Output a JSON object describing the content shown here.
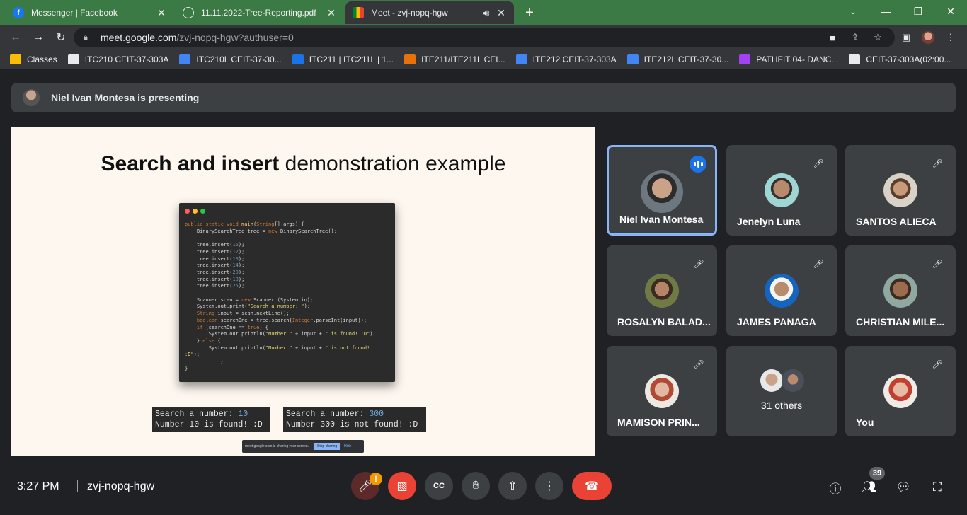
{
  "browser": {
    "tabs": [
      {
        "title": "Messenger | Facebook",
        "icon": "facebook-icon"
      },
      {
        "title": "11.11.2022-Tree-Reporting.pdf",
        "icon": "globe-icon"
      },
      {
        "title": "Meet - zvj-nopq-hgw",
        "icon": "meet-icon",
        "active": true
      }
    ],
    "url_host": "meet.google.com",
    "url_path": "/zvj-nopq-hgw?authuser=0",
    "bookmarks": [
      {
        "label": "Classes",
        "color": "#fbbc04"
      },
      {
        "label": "ITC210 CEIT-37-303A",
        "color": "#e8eaed"
      },
      {
        "label": "ITC210L CEIT-37-30...",
        "color": "#4285f4"
      },
      {
        "label": "ITC211 | ITC211L | 1...",
        "color": "#1a73e8"
      },
      {
        "label": "ITE211/ITE211L CEI...",
        "color": "#e8710a"
      },
      {
        "label": "ITE212 CEIT-37-303A",
        "color": "#4285f4"
      },
      {
        "label": "ITE212L CEIT-37-30...",
        "color": "#4285f4"
      },
      {
        "label": "PATHFIT 04- DANC...",
        "color": "#a142f4"
      },
      {
        "label": "CEIT-37-303A(02:00...",
        "color": "#e8eaed"
      }
    ]
  },
  "meet": {
    "presenting_text": "Niel Ivan Montesa is presenting",
    "slide": {
      "title_bold": "Search and insert",
      "title_rest": " demonstration example",
      "console1_line1_prefix": "Search a number: ",
      "console1_line1_value": "10",
      "console1_line2": "Number 10 is found! :D",
      "console2_line1_prefix": "Search a number: ",
      "console2_line1_value": "300",
      "console2_line2": "Number 300 is not found! :D",
      "share_text": "meet.google.com is sharing your screen.",
      "stop_sharing": "Stop sharing",
      "hide": "Hide"
    },
    "participants": [
      {
        "name": "Niel Ivan Montesa",
        "speaking": true
      },
      {
        "name": "Jenelyn Luna",
        "muted": true
      },
      {
        "name": "SANTOS ALIECA",
        "muted": true
      },
      {
        "name": "ROSALYN BALAD...",
        "muted": true
      },
      {
        "name": "JAMES PANAGA",
        "muted": true
      },
      {
        "name": "CHRISTIAN MILE...",
        "muted": true
      },
      {
        "name": "MAMISON PRIN...",
        "muted": true
      },
      {
        "name": "31 others"
      },
      {
        "name": "You",
        "muted": true
      }
    ],
    "bottom": {
      "time": "3:27 PM",
      "meeting_code": "zvj-nopq-hgw",
      "warning_badge": "!",
      "people_count": "39"
    },
    "colors": {
      "accent": "#8ab4f8",
      "end_call": "#ea4335",
      "tab_strip": "#3c7a45"
    }
  }
}
